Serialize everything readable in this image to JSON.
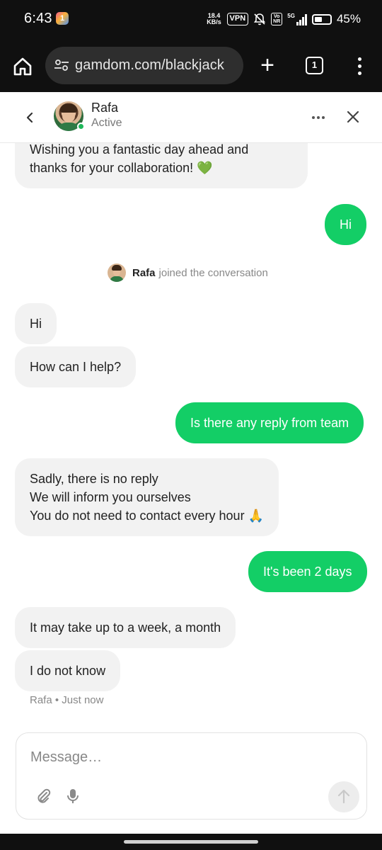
{
  "status_bar": {
    "time": "6:43",
    "app_icon_text": "1",
    "net_speed_top": "18.4",
    "net_speed_bottom": "KB/s",
    "vpn": "VPN",
    "volte_top": "Vo",
    "volte_bottom": "NR",
    "network": "5G",
    "battery_percent": "45%"
  },
  "browser": {
    "url": "gamdom.com/blackjack",
    "tab_count": "1"
  },
  "chat_header": {
    "agent_name": "Rafa",
    "agent_status": "Active"
  },
  "messages": [
    {
      "direction": "in",
      "lines": [
        "Wishing you a fantastic day ahead and",
        "thanks for your collaboration! 💚"
      ]
    },
    {
      "direction": "out",
      "lines": [
        "Hi"
      ]
    },
    {
      "direction": "in",
      "lines": [
        "Hi"
      ]
    },
    {
      "direction": "in",
      "lines": [
        "How can I help?"
      ]
    },
    {
      "direction": "out",
      "lines": [
        "Is there any reply from team"
      ]
    },
    {
      "direction": "in",
      "lines": [
        "Sadly, there is no reply",
        "We will inform you ourselves",
        "You do not need to contact every hour 🙏"
      ]
    },
    {
      "direction": "out",
      "lines": [
        "It's been 2 days"
      ]
    },
    {
      "direction": "in",
      "lines": [
        "It may take up to a week, a month"
      ]
    },
    {
      "direction": "in",
      "lines": [
        "I do not know"
      ]
    }
  ],
  "system_event": {
    "name": "Rafa",
    "text": "joined the conversation"
  },
  "last_meta": "Rafa • Just now",
  "composer": {
    "placeholder": "Message…"
  },
  "colors": {
    "outgoing_bubble": "#13ce66",
    "incoming_bubble": "#f2f2f2",
    "online_indicator": "#1fb85a"
  }
}
